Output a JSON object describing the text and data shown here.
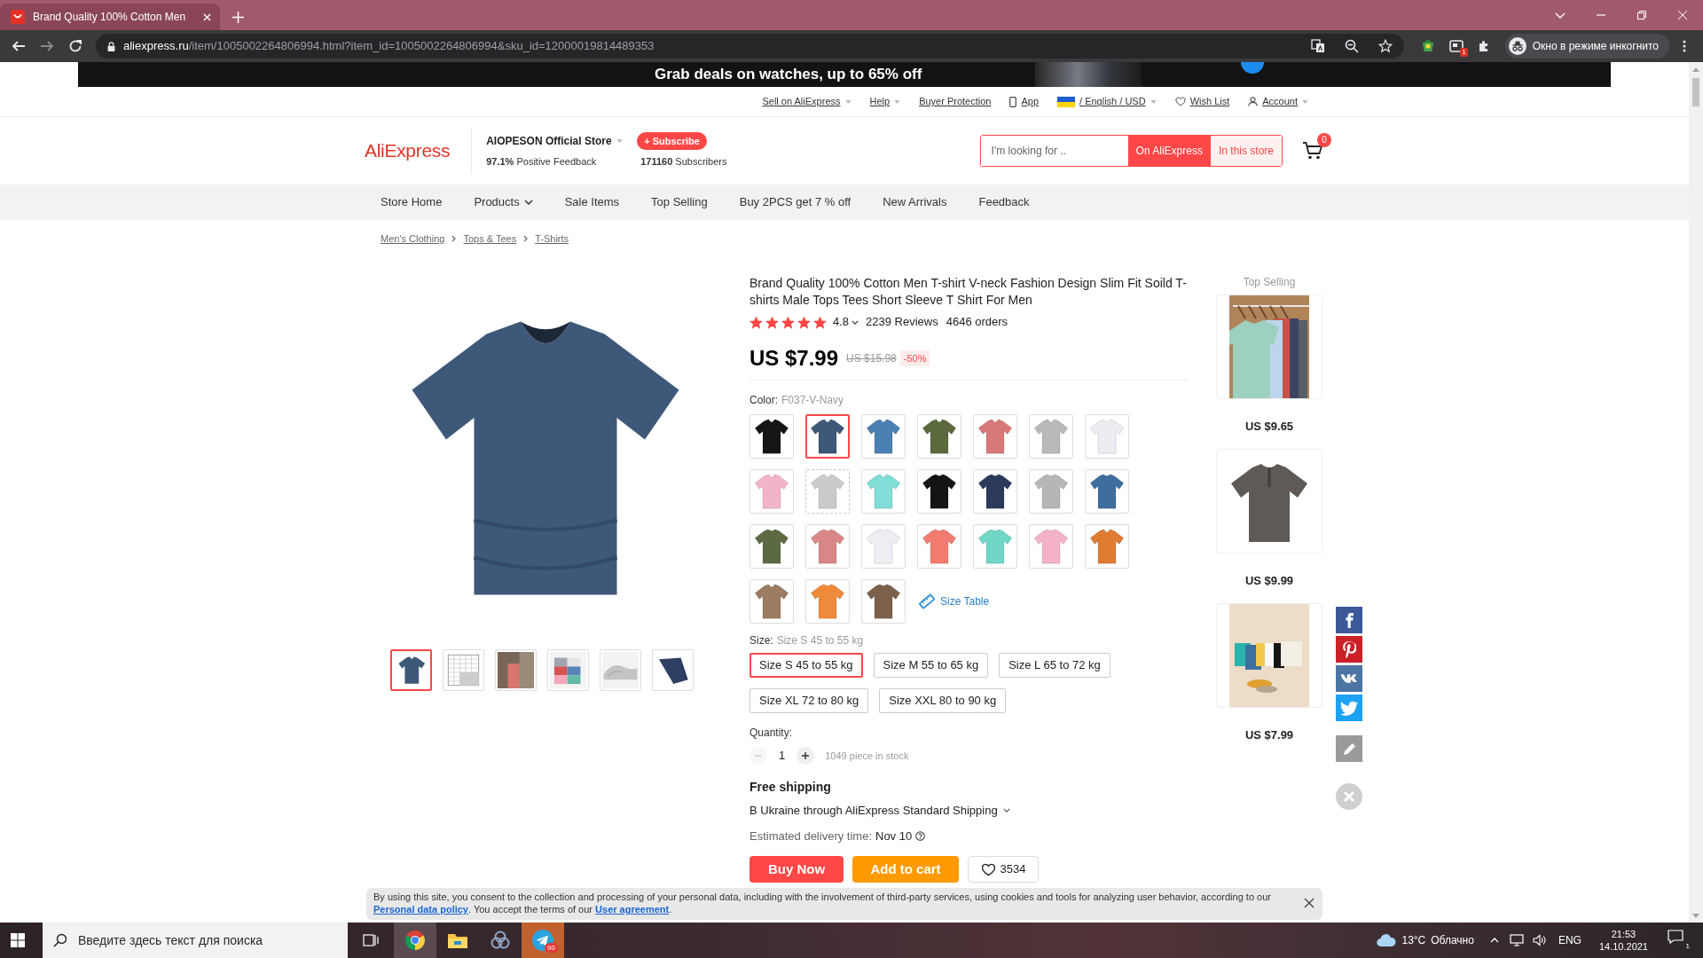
{
  "browser": {
    "tab": {
      "title": "Brand Quality 100% Cotton Men"
    },
    "url_host": "aliexpress.ru",
    "url_path": "/item/1005002264806994.html?item_id=1005002264806994&sku_id=12000019814489353",
    "extension_badge": "1",
    "profile": "Окно в режиме инкогнито"
  },
  "promo_banner": {
    "text": "Grab deals on watches, up to 65% off"
  },
  "top_bar": {
    "items": [
      {
        "kind": "dropdown",
        "label": "Sell on AliExpress"
      },
      {
        "kind": "dropdown",
        "label": "Help"
      },
      {
        "kind": "plain",
        "label": "Buyer Protection"
      },
      {
        "kind": "app",
        "label": "App"
      },
      {
        "kind": "language",
        "label": "/ English / USD"
      },
      {
        "kind": "wishlist",
        "label": "Wish List"
      },
      {
        "kind": "account",
        "label": "Account"
      }
    ]
  },
  "store_header": {
    "logo": "AliExpress",
    "store_name": "AIOPESON Official Store",
    "subscribe": "+ Subscribe",
    "feedback": "**97.1%** Positive Feedback",
    "subscribers": "**171160** Subscribers",
    "search": {
      "placeholder": "I'm looking for ..",
      "scopes": [
        {
          "label": "On AliExpress",
          "selected": true
        },
        {
          "label": "In this store",
          "selected": false
        }
      ]
    },
    "cart_count": "0"
  },
  "store_nav": [
    {
      "label": "Store Home",
      "dropdown": false
    },
    {
      "label": "Products",
      "dropdown": true
    },
    {
      "label": "Sale Items",
      "dropdown": false
    },
    {
      "label": "Top Selling",
      "dropdown": false
    },
    {
      "label": "Buy 2PCS get 7 % off",
      "dropdown": false
    },
    {
      "label": "New Arrivals",
      "dropdown": false
    },
    {
      "label": "Feedback",
      "dropdown": false
    }
  ],
  "breadcrumb": [
    "Men's Clothing",
    "Tops & Tees",
    "T-Shirts"
  ],
  "gallery": {
    "thumbnails": [
      {
        "kind": "shirt",
        "selected": true
      },
      {
        "kind": "size-chart",
        "selected": false
      },
      {
        "kind": "model",
        "selected": false
      },
      {
        "kind": "folded",
        "selected": false
      },
      {
        "kind": "fabric",
        "selected": false
      },
      {
        "kind": "sleeve",
        "selected": false
      }
    ]
  },
  "product": {
    "title": "Brand Quality 100% Cotton Men T-shirt V-neck Fashion Design Slim Fit Soild T-shirts Male Tops Tees Short Sleeve T Shirt For Men",
    "rating": {
      "stars": 5,
      "score": "4.8",
      "reviews": "2239 Reviews",
      "orders": "4646 orders"
    },
    "price": "US $7.99",
    "old_price": "US $15.98",
    "discount": "-50%",
    "color": {
      "label": "Color:",
      "value": "F037-V-Navy",
      "swatches": [
        {
          "kind": "v-neck",
          "color": "#151515",
          "selected": false,
          "available": true
        },
        {
          "kind": "v-neck",
          "color": "#3e5879",
          "selected": true,
          "available": true
        },
        {
          "kind": "v-neck",
          "color": "#4a80b2",
          "selected": false,
          "available": true
        },
        {
          "kind": "v-neck",
          "color": "#5b6a3c",
          "selected": false,
          "available": true
        },
        {
          "kind": "v-neck",
          "color": "#d9787a",
          "selected": false,
          "available": true
        },
        {
          "kind": "v-neck",
          "color": "#b9b9b9",
          "selected": false,
          "available": true
        },
        {
          "kind": "v-neck",
          "color": "#ececf3",
          "selected": false,
          "available": true
        },
        {
          "kind": "v-neck",
          "color": "#f2b3cb",
          "selected": false,
          "available": true
        },
        {
          "kind": "v-neck",
          "color": "#cacaca",
          "selected": false,
          "available": false
        },
        {
          "kind": "v-neck",
          "color": "#80ddd8",
          "selected": false,
          "available": true
        },
        {
          "kind": "crew",
          "color": "#141414",
          "selected": false,
          "available": true
        },
        {
          "kind": "crew",
          "color": "#2b3a5a",
          "selected": false,
          "available": true
        },
        {
          "kind": "crew",
          "color": "#b6b6b6",
          "selected": false,
          "available": true
        },
        {
          "kind": "crew",
          "color": "#3f6e9e",
          "selected": false,
          "available": true
        },
        {
          "kind": "crew",
          "color": "#5c6a44",
          "selected": false,
          "available": true
        },
        {
          "kind": "crew",
          "color": "#d98686",
          "selected": false,
          "available": true
        },
        {
          "kind": "crew",
          "color": "#ededf3",
          "selected": false,
          "available": true
        },
        {
          "kind": "crew",
          "color": "#f27b70",
          "selected": false,
          "available": true
        },
        {
          "kind": "crew",
          "color": "#70d7c7",
          "selected": false,
          "available": true
        },
        {
          "kind": "crew",
          "color": "#f3b2c7",
          "selected": false,
          "available": true
        },
        {
          "kind": "v-neck",
          "color": "#e07b32",
          "selected": false,
          "available": true
        },
        {
          "kind": "v-neck",
          "color": "#9b7c61",
          "selected": false,
          "available": true
        },
        {
          "kind": "crew",
          "color": "#f08a3b",
          "selected": false,
          "available": true
        },
        {
          "kind": "crew",
          "color": "#7b604a",
          "selected": false,
          "available": true
        }
      ]
    },
    "size_table": "Size Table",
    "size": {
      "label": "Size:",
      "value": "Size S 45 to 55 kg",
      "options": [
        {
          "label": "Size S 45 to 55 kg",
          "selected": true
        },
        {
          "label": "Size M 55 to 65 kg",
          "selected": false
        },
        {
          "label": "Size L 65 to 72 kg",
          "selected": false
        },
        {
          "label": "Size XL 72 to 80 kg",
          "selected": false
        },
        {
          "label": "Size XXL 80 to 90 kg",
          "selected": false
        }
      ]
    },
    "quantity": {
      "label": "Quantity:",
      "value": "1",
      "decrease_disabled": true,
      "stock": "1049 piece in stock"
    },
    "shipping": {
      "title": "Free shipping",
      "method": "В Ukraine through AliExpress Standard Shipping",
      "delivery_label": "Estimated delivery time:",
      "delivery_date": "Nov 10"
    },
    "actions": {
      "buy_now": "Buy Now",
      "add_to_cart": "Add to cart",
      "wishlist_count": "3534"
    }
  },
  "top_selling": {
    "title": "Top Selling",
    "items": [
      {
        "kind": "rack",
        "price": "US $9.65"
      },
      {
        "kind": "henley",
        "price": "US $9.99"
      },
      {
        "kind": "poster",
        "price": "US $7.99"
      }
    ]
  },
  "share_bar": [
    {
      "kind": "facebook"
    },
    {
      "kind": "pinterest"
    },
    {
      "kind": "vk"
    },
    {
      "kind": "twitter"
    }
  ],
  "cookie_notice": {
    "text_before": "By using this site, you consent to the collection and processing of your personal data, including with the involvement of third-party services, using cookies and tools for analyzing user behavior, according to our",
    "policy_link": "Personal data policy",
    "text_middle": ". You accept the terms of our",
    "agreement_link": "User agreement",
    "text_after": "."
  },
  "taskbar": {
    "search_placeholder": "Введите здесь текст для поиска",
    "apps": [
      {
        "kind": "task-view",
        "active": false,
        "flashing": false
      },
      {
        "kind": "browser",
        "active": true,
        "flashing": false
      },
      {
        "kind": "folder",
        "active": false,
        "flashing": false
      },
      {
        "kind": "rings",
        "active": false,
        "flashing": false
      },
      {
        "kind": "messenger",
        "active": false,
        "flashing": true,
        "badge": "90"
      }
    ],
    "temperature": "13°C",
    "condition": "Облачно",
    "language": "ENG",
    "time": "21:53",
    "date": "14.10.2021",
    "notifications": "1"
  }
}
